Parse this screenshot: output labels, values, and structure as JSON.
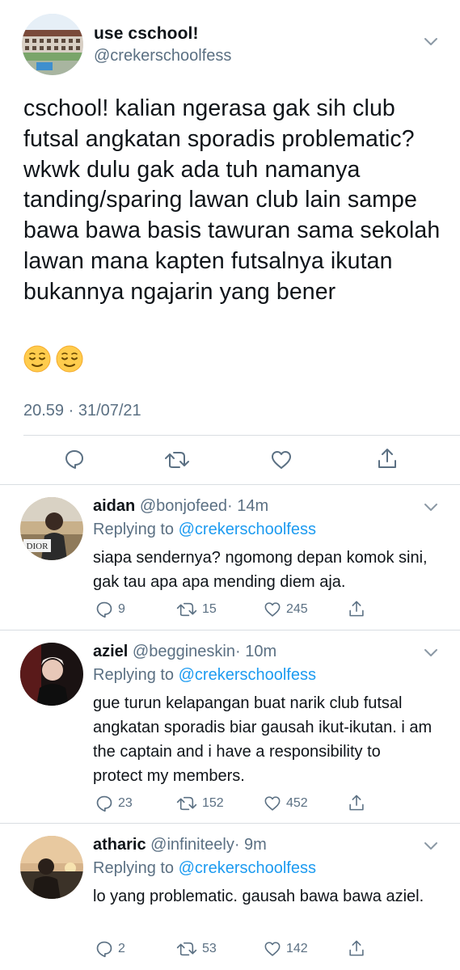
{
  "main": {
    "display_name": "use cschool!",
    "handle": "@crekerschoolfess",
    "text": "cschool! kalian ngerasa gak sih club futsal angkatan sporadis problematic? wkwk dulu gak ada tuh namanya tanding/sparing lawan club lain sampe bawa bawa basis tawuran sama sekolah lawan mana kapten futsalnya ikutan bukannya ngajarin yang bener",
    "emojis": [
      "relieved-face",
      "relieved-face"
    ],
    "timestamp": "20.59 · 31/07/21",
    "actions": [
      "reply-icon",
      "retweet-icon",
      "like-icon",
      "share-icon"
    ]
  },
  "replies": [
    {
      "name": "aidan",
      "handle": "@bonjofeed",
      "time": "· 14m",
      "replying_label": "Replying to",
      "replying_to": "@crekerschoolfess",
      "text": "siapa sendernya? ngomong depan komok sini, gak tau apa apa mending diem aja.",
      "replies": "9",
      "retweets": "15",
      "likes": "245",
      "avatar_text": "DIOR"
    },
    {
      "name": "aziel",
      "handle": "@beggineskin",
      "time": "· 10m",
      "replying_label": "Replying to",
      "replying_to": "@crekerschoolfess",
      "text": "gue turun kelapangan buat narik club futsal angkatan sporadis biar gausah ikut-ikutan. i am the captain and i have a responsibility to protect my members.",
      "replies": "23",
      "retweets": "152",
      "likes": "452"
    },
    {
      "name": "atharic",
      "handle": "@infiniteely",
      "time": "· 9m",
      "replying_label": "Replying to",
      "replying_to": "@crekerschoolfess",
      "text": "lo yang problematic. gausah bawa bawa aziel.",
      "replies": "2",
      "retweets": "53",
      "likes": "142"
    }
  ],
  "colors": {
    "accent": "#1d9bf0",
    "secondary_text": "#5b7083",
    "divider": "#d9dee2"
  }
}
